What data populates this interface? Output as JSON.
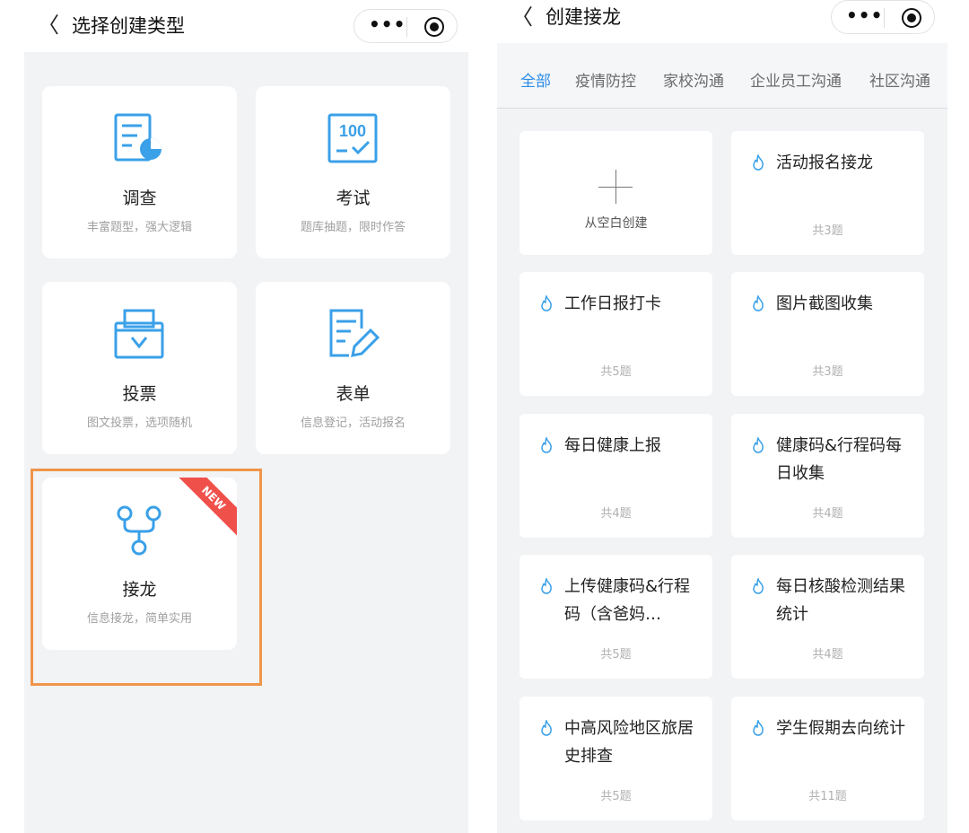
{
  "left": {
    "back_glyph": "〈",
    "title": "选择创建类型",
    "capsule_dots": "•••",
    "cards": [
      {
        "title": "调查",
        "desc": "丰富题型，强大逻辑",
        "icon": "survey-icon"
      },
      {
        "title": "考试",
        "desc": "题库抽题，限时作答",
        "icon": "exam-icon"
      },
      {
        "title": "投票",
        "desc": "图文投票，选项随机",
        "icon": "vote-icon"
      },
      {
        "title": "表单",
        "desc": "信息登记，活动报名",
        "icon": "form-icon"
      },
      {
        "title": "接龙",
        "desc": "信息接龙，简单实用",
        "icon": "relay-icon",
        "badge": "NEW"
      }
    ]
  },
  "right": {
    "back_glyph": "〈",
    "title": "创建接龙",
    "capsule_dots": "•••",
    "tabs": [
      "全部",
      "疫情防控",
      "家校沟通",
      "企业员工沟通",
      "社区沟通"
    ],
    "blank_label": "从空白创建",
    "templates": [
      {
        "name": "活动报名接龙",
        "count": "共3题"
      },
      {
        "name": "工作日报打卡",
        "count": "共5题"
      },
      {
        "name": "图片截图收集",
        "count": "共3题"
      },
      {
        "name": "每日健康上报",
        "count": "共4题"
      },
      {
        "name": "健康码&行程码每日收集",
        "count": "共4题"
      },
      {
        "name": "上传健康码&行程码（含爸妈…",
        "count": "共5题"
      },
      {
        "name": "每日核酸检测结果统计",
        "count": "共4题"
      },
      {
        "name": "中高风险地区旅居史排查",
        "count": "共5题"
      },
      {
        "name": "学生假期去向统计",
        "count": "共11题"
      }
    ]
  },
  "colors": {
    "accent": "#2b8ce6",
    "icon_blue": "#3aa0e8",
    "badge_red": "#f0504a",
    "highlight": "#f0954a"
  }
}
